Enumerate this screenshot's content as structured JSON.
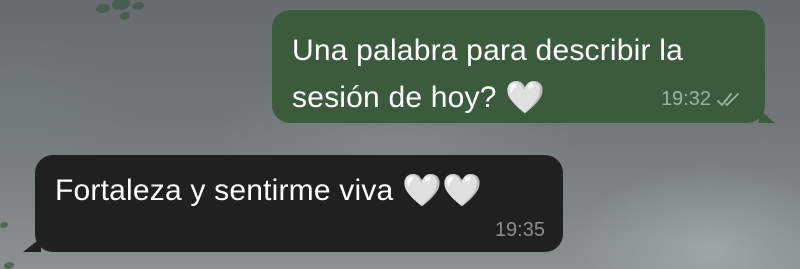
{
  "messages": {
    "outgoing": {
      "text": "Una palabra para describir la sesión de hoy?",
      "emoji": "🤍",
      "time": "19:32",
      "status_icon": "double-check-icon"
    },
    "incoming": {
      "text": "Fortaleza y sentirme viva",
      "emoji": "🤍🤍",
      "time": "19:35"
    }
  },
  "colors": {
    "outgoing_bubble": "#3c5a3c",
    "incoming_bubble": "#1f2020",
    "text": "#ffffff"
  }
}
